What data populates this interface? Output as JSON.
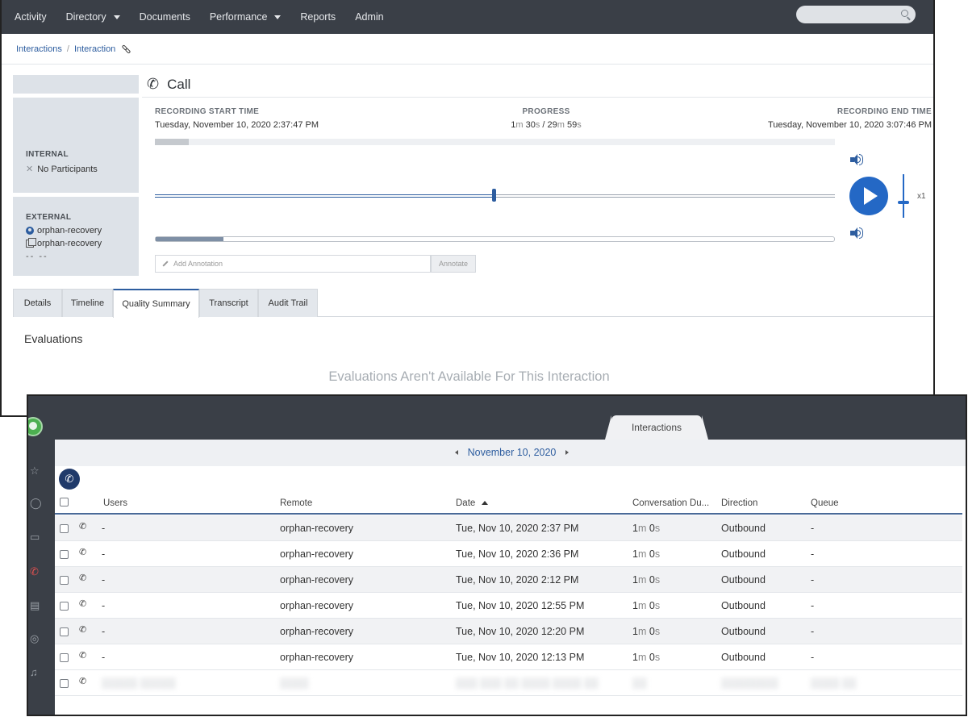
{
  "top": {
    "nav": {
      "items": [
        {
          "label": "Activity",
          "dropdown": false
        },
        {
          "label": "Directory",
          "dropdown": true
        },
        {
          "label": "Documents",
          "dropdown": false
        },
        {
          "label": "Performance",
          "dropdown": true
        },
        {
          "label": "Reports",
          "dropdown": false
        },
        {
          "label": "Admin",
          "dropdown": false
        }
      ],
      "search_placeholder": ""
    },
    "breadcrumb": {
      "first": "Interactions",
      "separator": "/",
      "second": "Interaction"
    },
    "interaction": {
      "title": "Call",
      "internal": {
        "label": "INTERNAL",
        "value": "No Participants"
      },
      "external": {
        "label": "EXTERNAL",
        "remote_name": "orphan-recovery",
        "remote_number": "orphan-recovery",
        "extra": "-- --"
      }
    },
    "recording": {
      "start_label": "RECORDING START TIME",
      "start_value": "Tuesday, November 10, 2020 2:37:47 PM",
      "progress_label": "PROGRESS",
      "progress": {
        "cur_min": "1",
        "cur_sec": "30",
        "total_min": "29",
        "total_sec": "59",
        "m": "m",
        "s": "s",
        "sep": " / "
      },
      "progress_fraction": 0.05,
      "end_label": "RECORDING END TIME",
      "end_value": "Tuesday, November 10, 2020 3:07:46 PM",
      "speed": "x1"
    },
    "annotation": {
      "placeholder": "Add Annotation",
      "button": "Annotate"
    },
    "tabs": [
      "Details",
      "Timeline",
      "Quality Summary",
      "Transcript",
      "Audit Trail"
    ],
    "active_tab": "Quality Summary",
    "evaluations": {
      "title": "Evaluations",
      "empty": "Evaluations Aren't Available For This Interaction"
    }
  },
  "bottom": {
    "tab": "Interactions",
    "date": "November 10, 2020",
    "columns": [
      "Users",
      "Remote",
      "Date",
      "Conversation Du...",
      "Direction",
      "Queue"
    ],
    "rows": [
      {
        "user": "-",
        "remote": "orphan-recovery",
        "date": "Tue, Nov 10, 2020 2:37 PM",
        "dur_n1": "1",
        "dur_u1": "m",
        "dur_n2": "0",
        "dur_u2": "s",
        "direction": "Outbound",
        "queue": "-"
      },
      {
        "user": "-",
        "remote": "orphan-recovery",
        "date": "Tue, Nov 10, 2020 2:36 PM",
        "dur_n1": "1",
        "dur_u1": "m",
        "dur_n2": "0",
        "dur_u2": "s",
        "direction": "Outbound",
        "queue": "-"
      },
      {
        "user": "-",
        "remote": "orphan-recovery",
        "date": "Tue, Nov 10, 2020 2:12 PM",
        "dur_n1": "1",
        "dur_u1": "m",
        "dur_n2": "0",
        "dur_u2": "s",
        "direction": "Outbound",
        "queue": "-"
      },
      {
        "user": "-",
        "remote": "orphan-recovery",
        "date": "Tue, Nov 10, 2020 12:55 PM",
        "dur_n1": "1",
        "dur_u1": "m",
        "dur_n2": "0",
        "dur_u2": "s",
        "direction": "Outbound",
        "queue": "-"
      },
      {
        "user": "-",
        "remote": "orphan-recovery",
        "date": "Tue, Nov 10, 2020 12:20 PM",
        "dur_n1": "1",
        "dur_u1": "m",
        "dur_n2": "0",
        "dur_u2": "s",
        "direction": "Outbound",
        "queue": "-"
      },
      {
        "user": "-",
        "remote": "orphan-recovery",
        "date": "Tue, Nov 10, 2020 12:13 PM",
        "dur_n1": "1",
        "dur_u1": "m",
        "dur_n2": "0",
        "dur_u2": "s",
        "direction": "Outbound",
        "queue": "-"
      }
    ]
  },
  "icons": {
    "accent": "#2468c5",
    "nav_bg": "#3a3f47",
    "link": "#2d5d9f"
  }
}
